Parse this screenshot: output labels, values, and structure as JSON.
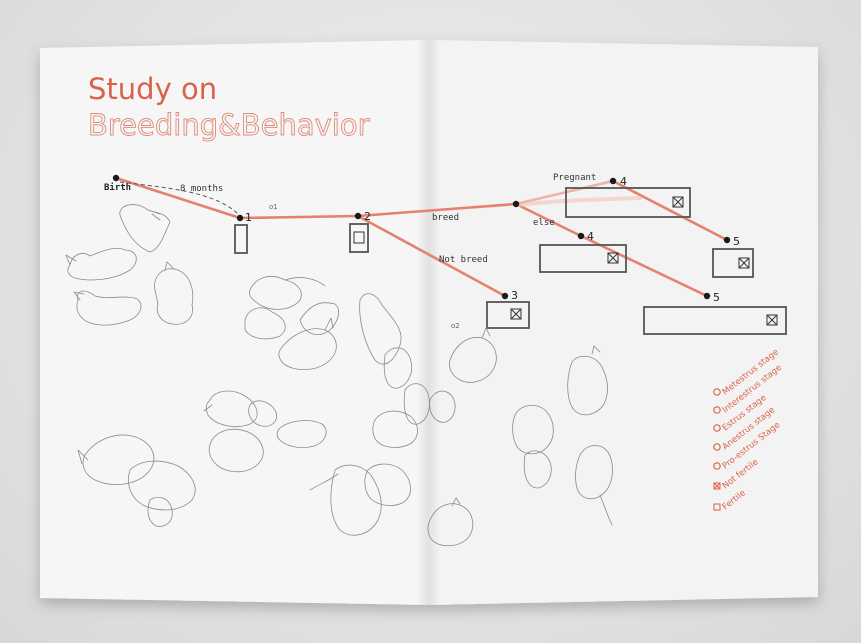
{
  "title": {
    "line1": "Study on",
    "line2": "Breeding&Behavior"
  },
  "nodes": {
    "birth": "Birth",
    "n1": "1",
    "n2": "2",
    "n3": "3",
    "n4a": "4",
    "n4b": "4",
    "n5a": "5",
    "n5b": "5"
  },
  "annotations": {
    "months": "8 months",
    "small_1": "o1",
    "small_2": "o2"
  },
  "edges": {
    "breed": "breed",
    "not_breed": "Not breed",
    "pregnant": "Pregnant",
    "else": "else"
  },
  "legend": [
    {
      "label": "Metestrus stage",
      "marker": "circle"
    },
    {
      "label": "Interestrus stage",
      "marker": "circle"
    },
    {
      "label": "Estrus stage",
      "marker": "circle"
    },
    {
      "label": "Anestrus stage",
      "marker": "circle"
    },
    {
      "label": "Pro-estrus Stage",
      "marker": "circle"
    },
    {
      "label": "Not fertile",
      "marker": "crossed-square"
    },
    {
      "label": "Fertile",
      "marker": "square"
    }
  ],
  "colors": {
    "accent": "#d9634a",
    "line": "#e4826d",
    "ink": "#1a1a1a"
  }
}
